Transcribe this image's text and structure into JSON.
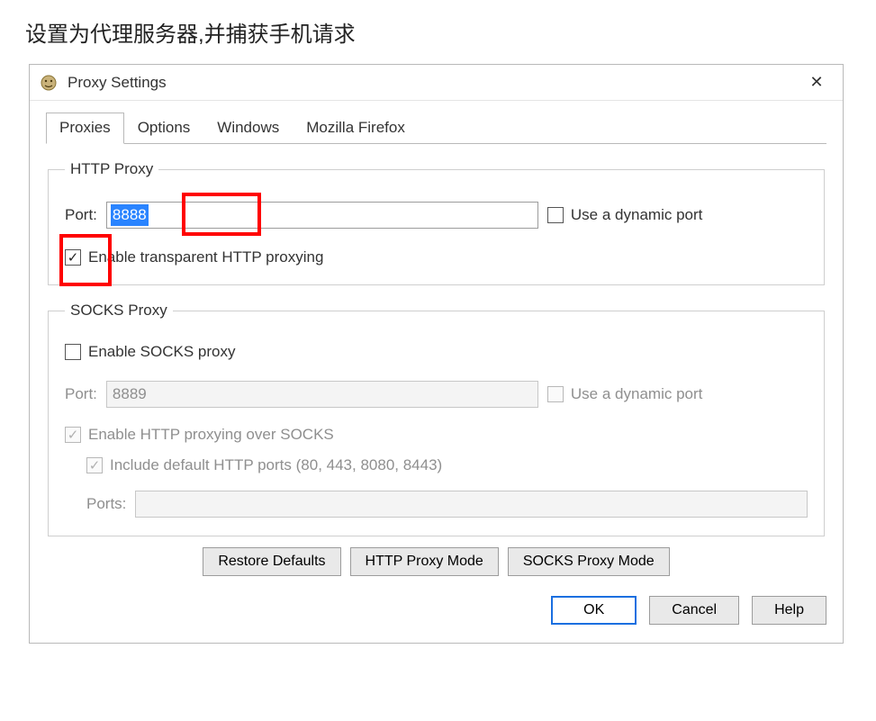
{
  "heading": "设置为代理服务器,并捕获手机请求",
  "window": {
    "title": "Proxy Settings",
    "close_glyph": "✕"
  },
  "tabs": [
    "Proxies",
    "Options",
    "Windows",
    "Mozilla Firefox"
  ],
  "active_tab": 0,
  "http": {
    "legend": "HTTP Proxy",
    "port_label": "Port:",
    "port_value": "8888",
    "dynamic_label": "Use a dynamic port",
    "dynamic_checked": false,
    "transparent_label": "Enable transparent HTTP proxying",
    "transparent_checked": true
  },
  "socks": {
    "legend": "SOCKS Proxy",
    "enable_label": "Enable SOCKS proxy",
    "enable_checked": false,
    "port_label": "Port:",
    "port_value": "8889",
    "dynamic_label": "Use a dynamic port",
    "dynamic_checked": false,
    "over_label": "Enable HTTP proxying over SOCKS",
    "over_checked": true,
    "include_label": "Include default HTTP ports (80, 443, 8080, 8443)",
    "include_checked": true,
    "ports_label": "Ports:",
    "ports_value": ""
  },
  "mode_buttons": {
    "restore": "Restore Defaults",
    "http": "HTTP Proxy Mode",
    "socks": "SOCKS Proxy Mode"
  },
  "footer": {
    "ok": "OK",
    "cancel": "Cancel",
    "help": "Help"
  }
}
